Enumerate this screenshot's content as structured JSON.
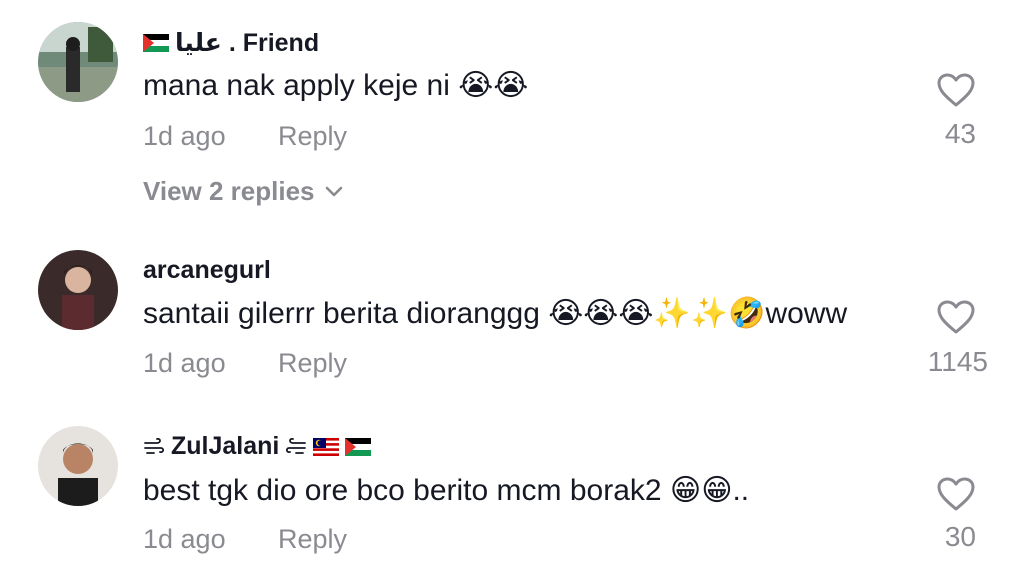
{
  "comments": [
    {
      "username": "عليا . Friend",
      "text": "mana nak apply keje ni 😭😭",
      "time": "1d ago",
      "reply_label": "Reply",
      "likes": "43",
      "view_replies": "View 2 replies"
    },
    {
      "username": "arcanegurl",
      "text": "santaii gilerrr berita dioranggg 😭😭😭✨✨🤣woww",
      "time": "1d ago",
      "reply_label": "Reply",
      "likes": "1145"
    },
    {
      "username": "ZulJalani",
      "text": "best tgk dio ore bco berito mcm borak2 😁😁..",
      "time": "1d ago",
      "reply_label": "Reply",
      "likes": "30"
    }
  ],
  "colors": {
    "primary_text": "#161823",
    "secondary_text": "#8a8b91",
    "background": "#ffffff"
  }
}
